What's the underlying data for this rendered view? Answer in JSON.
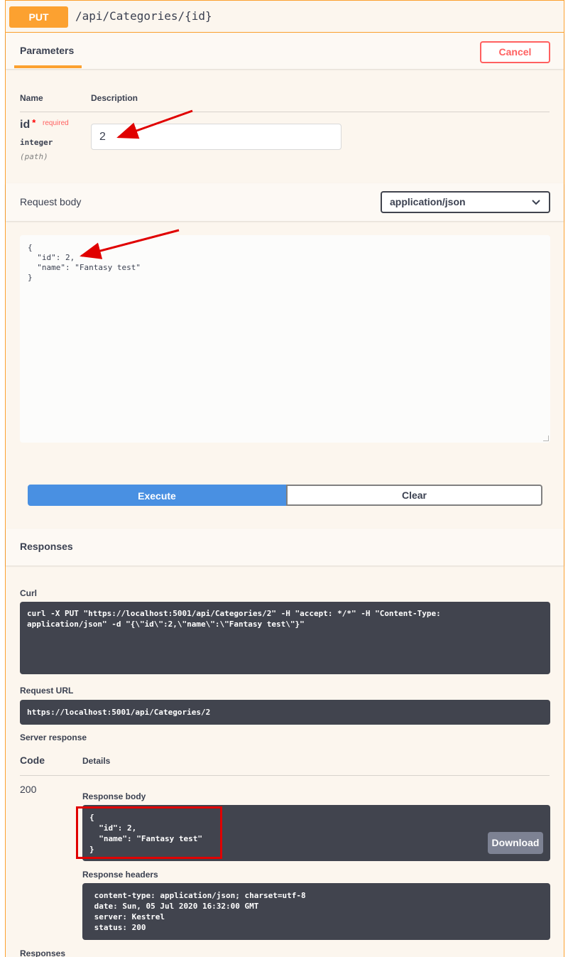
{
  "operation": {
    "method": "PUT",
    "path": "/api/Categories/{id}"
  },
  "parameters_section": {
    "tab_label": "Parameters",
    "cancel_label": "Cancel",
    "col_name": "Name",
    "col_description": "Description"
  },
  "param_id": {
    "name": "id",
    "required_star": "*",
    "required_label": "required",
    "type": "integer",
    "location": "(path)",
    "value": "2"
  },
  "request_body": {
    "label": "Request body",
    "content_type": "application/json",
    "body_text": "{\n  \"id\": 2,\n  \"name\": \"Fantasy test\"\n}"
  },
  "actions": {
    "execute_label": "Execute",
    "clear_label": "Clear"
  },
  "responses": {
    "heading": "Responses",
    "curl_label": "Curl",
    "curl_text": "curl -X PUT \"https://localhost:5001/api/Categories/2\" -H \"accept: */*\" -H \"Content-Type:\napplication/json\" -d \"{\\\"id\\\":2,\\\"name\\\":\\\"Fantasy test\\\"}\"",
    "request_url_label": "Request URL",
    "request_url": "https://localhost:5001/api/Categories/2",
    "server_response_label": "Server response",
    "col_code": "Code",
    "col_details": "Details",
    "code": "200",
    "response_body_label": "Response body",
    "response_body": "{\n  \"id\": 2,\n  \"name\": \"Fantasy test\"\n}",
    "download_label": "Download",
    "response_headers_label": "Response headers",
    "response_headers": " content-type: application/json; charset=utf-8\n date: Sun, 05 Jul 2020 16:32:00 GMT\n server: Kestrel\n status: 200",
    "footer_heading": "Responses"
  },
  "colors": {
    "put_accent": "#fca130",
    "execute_blue": "#4990e2",
    "cancel_red": "#ff6060",
    "code_bg": "#41444e",
    "annotation_red": "#e00000"
  },
  "icons": {
    "select_chevron": "chevron-down-icon"
  }
}
